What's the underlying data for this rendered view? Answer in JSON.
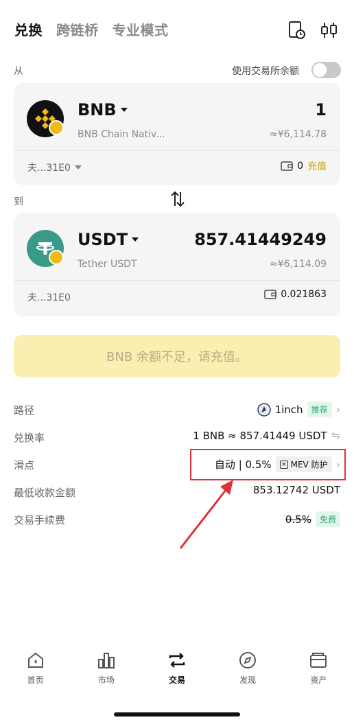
{
  "header": {
    "tabs": [
      {
        "label": "兑换",
        "active": true
      },
      {
        "label": "跨链桥",
        "active": false
      },
      {
        "label": "专业模式",
        "active": false
      }
    ],
    "history_icon": "history-icon",
    "settings_icon": "filter-icon"
  },
  "from_section": {
    "label": "从",
    "use_balance_label": "使用交易所余额",
    "use_balance_enabled": false,
    "token": {
      "symbol": "BNB",
      "full_name": "BNB Chain Nativ...",
      "amount": "1",
      "fiat": "≈¥6,114.78",
      "wallet": "夫...31E0",
      "balance": "0",
      "deposit_label": "充值"
    }
  },
  "to_section": {
    "label": "到",
    "token": {
      "symbol": "USDT",
      "full_name": "Tether USDT",
      "amount": "857.41449249",
      "fiat": "≈¥6,114.09",
      "wallet": "夫...31E0",
      "balance": "0.021863"
    }
  },
  "cta": {
    "label": "BNB 余额不足，请充值。"
  },
  "details": {
    "route": {
      "label": "路径",
      "value": "1inch",
      "badge": "推荐"
    },
    "rate": {
      "label": "兑换率",
      "value": "1 BNB ≈ 857.41449 USDT"
    },
    "slippage": {
      "label": "滑点",
      "value": "自动 | 0.5%",
      "mev_label": "MEV 防护"
    },
    "min_receive": {
      "label": "最低收款金额",
      "value": "853.12742 USDT"
    },
    "fee": {
      "label": "交易手续费",
      "value": "0.5%",
      "badge": "免费"
    }
  },
  "bottom_nav": [
    {
      "label": "首页",
      "icon": "home-icon",
      "active": false
    },
    {
      "label": "市场",
      "icon": "market-icon",
      "active": false
    },
    {
      "label": "交易",
      "icon": "trade-icon",
      "active": true
    },
    {
      "label": "发现",
      "icon": "compass-icon",
      "active": false
    },
    {
      "label": "资产",
      "icon": "wallet-icon",
      "active": false
    }
  ],
  "colors": {
    "accent_yellow": "#f3b919",
    "cta_bg": "#faeeb0",
    "highlight_red": "#e0303a",
    "green_badge": "#2aa86b"
  }
}
